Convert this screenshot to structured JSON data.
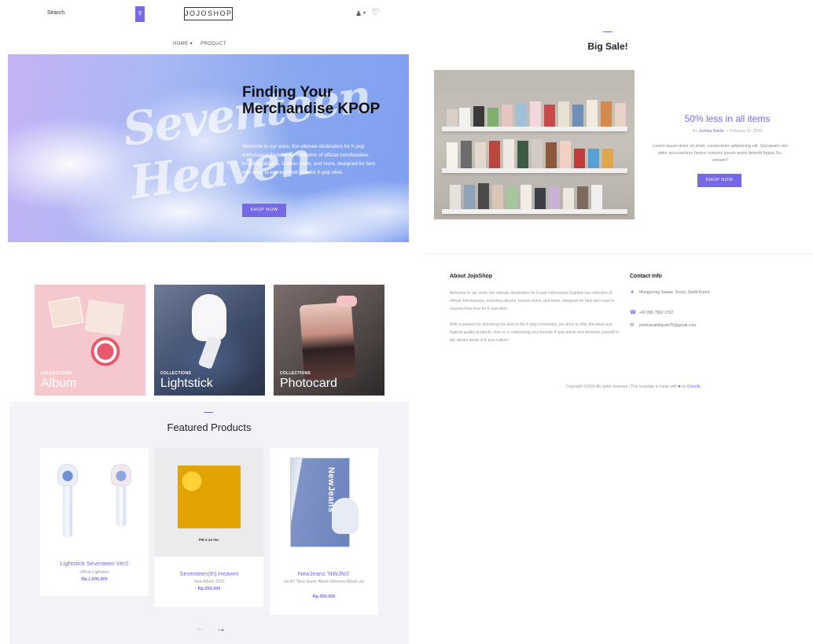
{
  "header": {
    "search_placeholder": "Search",
    "search_icon": "search-icon",
    "logo": "JOJOSHOP",
    "user_icon": "user-icon",
    "wishlist_icon": "heart-icon",
    "nav": [
      "HOME ▾",
      "PRODUCT"
    ]
  },
  "hero": {
    "title": "Finding Your Merchandise KPOP",
    "description": "Welcome to our store, the ultimate destination for K-pop enthusiasts! Explore our collection of official merchandise, including albums, fashion items, and more, designed for fans who want to express their love for K-pop idols.",
    "button": "SHOP NOW"
  },
  "collections": [
    {
      "kicker": "COLLECTIONS",
      "name": "Album"
    },
    {
      "kicker": "COLLECTIONS",
      "name": "Lightstick"
    },
    {
      "kicker": "COLLECTIONS",
      "name": "Photocard"
    }
  ],
  "featured": {
    "title": "Featured Products",
    "products": [
      {
        "name": "Lightstick Seventeen Ver2",
        "subtitle": "Official Lightstick",
        "price": "Rp.1,000,000"
      },
      {
        "name": "Seventeen(th) Heaven",
        "subtitle": "New Album 2023",
        "price": "Rp.250,000",
        "image_caption": "PM 2:14 Ver."
      },
      {
        "name": "NewJeans 'NWJNS'",
        "subtitle": "1st EP 'New Jeans' Album Weverse Album ver",
        "price": "Rp.350,000",
        "image_text": "NewJeans"
      }
    ]
  },
  "sale": {
    "section_title": "Big Sale!",
    "headline": "50% less in all items",
    "meta_prefix": "By",
    "author": "Jovinka Nabila",
    "date": "February 22, 2024",
    "description": "Lorem ipsum dolor sit amet, consectetur adipisicing elit. Quisquam iste dolor accusantium facere corporis ipsum animi deleniti fugiat. Ex, veniam?",
    "button": "SHOP NOW"
  },
  "footer": {
    "about_title": "About JojoShop",
    "about_p1": "Welcome to our store, the ultimate destination for K-pop enthusiasts! Explore our collection of official merchandise, including albums, fashion items, and more, designed for fans who want to express their love for K-pop idols.",
    "about_p2": "With a passion for delivering the best to the K-pop community, we strive to offer the latest and highest quality products. Join us in celebrating your favorite K-pop artists and immerse yourself in the vibrant world of K-pop culture!",
    "contact_title": "Contact Info",
    "address": "Mungyeong Saejae, Seoul, South Korea",
    "phone": "+62 896 7862 2762",
    "email": "jovinkanabilaputri75@gmail.com",
    "copyright_text": "Copyright ©2024 All rights reserved | This template is made with",
    "copyright_by": "by",
    "copyright_brand": "Colorlib"
  },
  "colors": {
    "accent": "#7669e6"
  }
}
